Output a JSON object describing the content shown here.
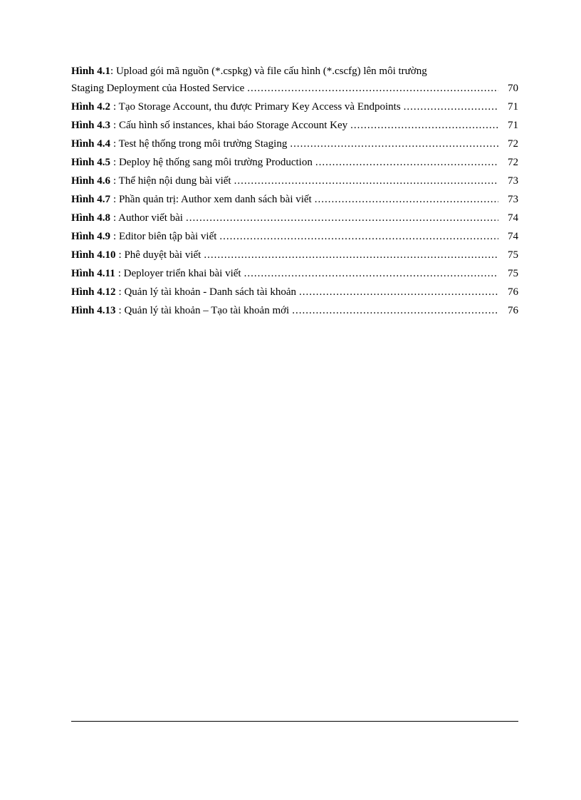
{
  "entries": [
    {
      "label": "Hình 4.1",
      "colon": ":",
      "desc_line1_full": "Hình 4.1: Upload gói mã nguồn (*.cspkg) và file cấu hình (*.cscfg) lên môi trường",
      "desc_line2": "Staging Deployment của Hosted Service",
      "page": "70",
      "multiline": true
    },
    {
      "label": "Hình 4.2",
      "colon": ":",
      "desc": "Tạo Storage Account, thu được Primary Key Access và Endpoints",
      "page": "71",
      "multiline": false,
      "tight": true
    },
    {
      "label": "Hình 4.3",
      "colon": ":",
      "desc": "Cấu hình số instances, khai báo Storage Account Key",
      "page": "71",
      "multiline": false
    },
    {
      "label": "Hình 4.4",
      "colon": ":",
      "desc": "Test hệ thống trong môi trường Staging",
      "page": "72",
      "multiline": false
    },
    {
      "label": "Hình 4.5",
      "colon": ":",
      "desc": "Deploy hệ thống sang môi trường Production",
      "page": "72",
      "multiline": false
    },
    {
      "label": "Hình 4.6",
      "colon": ":",
      "desc": "Thể hiện nội dung bài viết",
      "page": "73",
      "multiline": false
    },
    {
      "label": "Hình 4.7",
      "colon": ":",
      "desc": "Phần quản trị: Author xem danh sách bài viết",
      "page": "73",
      "multiline": false
    },
    {
      "label": "Hình 4.8",
      "colon": ":",
      "desc": "Author viết bài",
      "page": "74",
      "multiline": false
    },
    {
      "label": "Hình 4.9",
      "colon": ":",
      "desc": "Editor biên tập bài viết",
      "page": "74",
      "multiline": false
    },
    {
      "label": "Hình 4.10",
      "colon": ":",
      "desc": "Phê duyệt bài viết",
      "page": "75",
      "multiline": false
    },
    {
      "label": "Hình 4.11",
      "colon": ":",
      "desc": "Deployer triển khai bài viết",
      "page": "75",
      "multiline": false
    },
    {
      "label": "Hình 4.12",
      "colon": ":",
      "desc": "Quản lý tài khoản - Danh sách tài khoản",
      "page": "76",
      "multiline": false
    },
    {
      "label": "Hình 4.13",
      "colon": ":",
      "desc": "Quản lý tài khoản – Tạo tài khoản mới",
      "page": "76",
      "multiline": false
    }
  ]
}
